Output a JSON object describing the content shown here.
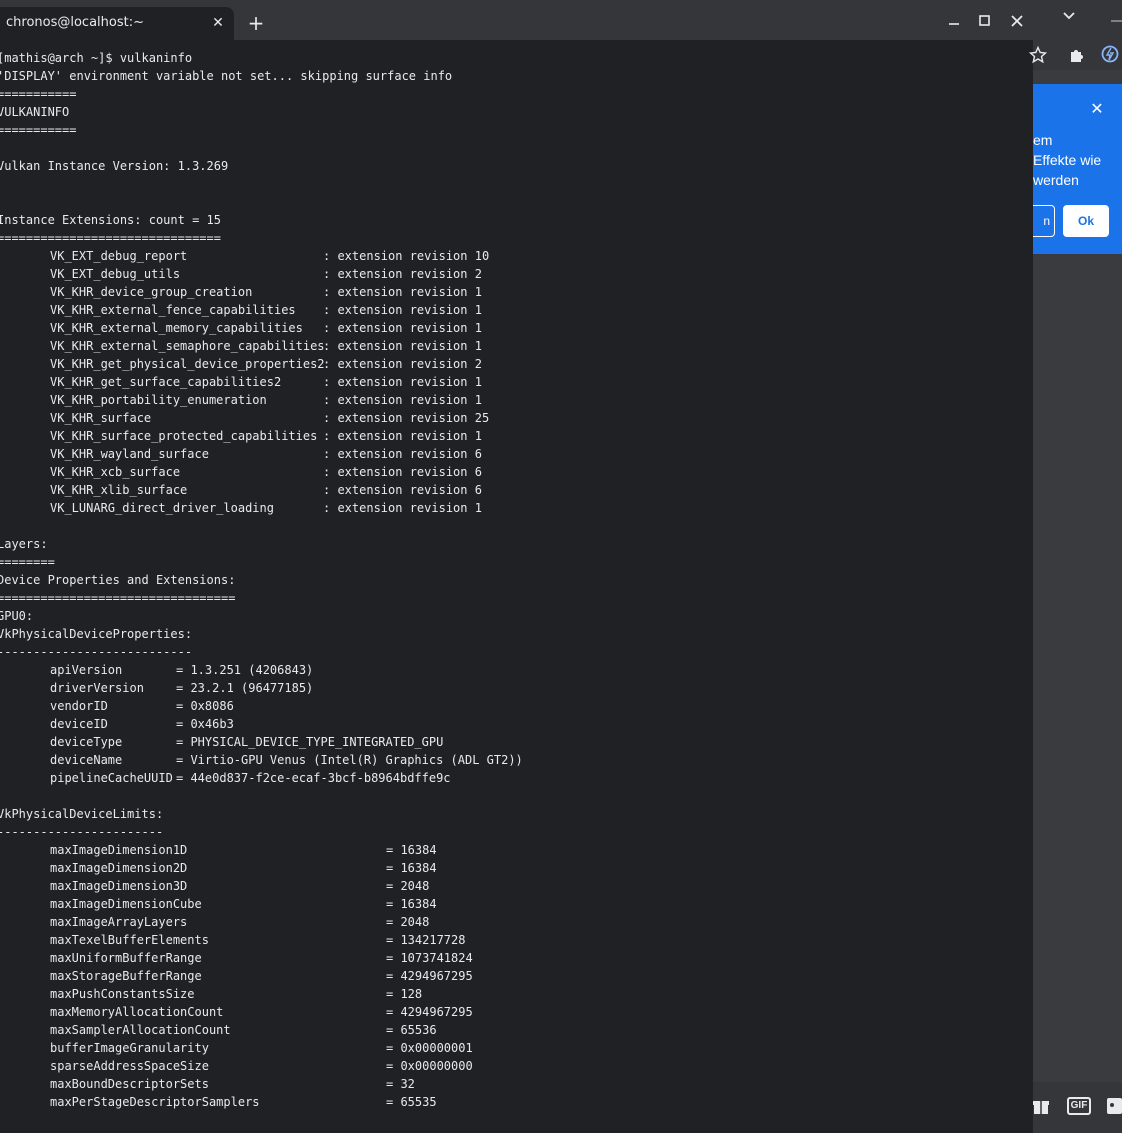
{
  "terminal": {
    "tab_title": "chronos@localhost:~",
    "tab_close_glyph": "✕",
    "new_tab_glyph": "+",
    "lines": [
      {
        "type": "single",
        "text": "[mathis@arch ~]$ vulkaninfo"
      },
      {
        "type": "single",
        "text": "'DISPLAY' environment variable not set... skipping surface info"
      },
      {
        "type": "single",
        "text": "==========="
      },
      {
        "type": "single",
        "text": "VULKANINFO"
      },
      {
        "type": "single",
        "text": "==========="
      },
      {
        "type": "single",
        "text": ""
      },
      {
        "type": "single",
        "text": "Vulkan Instance Version: 1.3.269"
      },
      {
        "type": "single",
        "text": ""
      },
      {
        "type": "single",
        "text": ""
      },
      {
        "type": "single",
        "text": "Instance Extensions: count = 15"
      },
      {
        "type": "single",
        "text": "==============================="
      },
      {
        "type": "ext",
        "name": "VK_EXT_debug_report",
        "value": ": extension revision 10"
      },
      {
        "type": "ext",
        "name": "VK_EXT_debug_utils",
        "value": ": extension revision 2"
      },
      {
        "type": "ext",
        "name": "VK_KHR_device_group_creation",
        "value": ": extension revision 1"
      },
      {
        "type": "ext",
        "name": "VK_KHR_external_fence_capabilities",
        "value": ": extension revision 1"
      },
      {
        "type": "ext",
        "name": "VK_KHR_external_memory_capabilities",
        "value": ": extension revision 1"
      },
      {
        "type": "ext",
        "name": "VK_KHR_external_semaphore_capabilities",
        "value": ": extension revision 1"
      },
      {
        "type": "ext",
        "name": "VK_KHR_get_physical_device_properties2",
        "value": ": extension revision 2"
      },
      {
        "type": "ext",
        "name": "VK_KHR_get_surface_capabilities2",
        "value": ": extension revision 1"
      },
      {
        "type": "ext",
        "name": "VK_KHR_portability_enumeration",
        "value": ": extension revision 1"
      },
      {
        "type": "ext",
        "name": "VK_KHR_surface",
        "value": ": extension revision 25"
      },
      {
        "type": "ext",
        "name": "VK_KHR_surface_protected_capabilities",
        "value": ": extension revision 1"
      },
      {
        "type": "ext",
        "name": "VK_KHR_wayland_surface",
        "value": ": extension revision 6"
      },
      {
        "type": "ext",
        "name": "VK_KHR_xcb_surface",
        "value": ": extension revision 6"
      },
      {
        "type": "ext",
        "name": "VK_KHR_xlib_surface",
        "value": ": extension revision 6"
      },
      {
        "type": "ext",
        "name": "VK_LUNARG_direct_driver_loading",
        "value": ": extension revision 1"
      },
      {
        "type": "single",
        "text": ""
      },
      {
        "type": "single",
        "text": "Layers:"
      },
      {
        "type": "single",
        "text": "========"
      },
      {
        "type": "single",
        "text": "Device Properties and Extensions:"
      },
      {
        "type": "single",
        "text": "================================="
      },
      {
        "type": "single",
        "text": "GPU0:"
      },
      {
        "type": "single",
        "text": "VkPhysicalDeviceProperties:"
      },
      {
        "type": "single",
        "text": "---------------------------"
      },
      {
        "type": "prop",
        "name": "apiVersion",
        "value": "= 1.3.251 (4206843)"
      },
      {
        "type": "prop",
        "name": "driverVersion",
        "value": "= 23.2.1 (96477185)"
      },
      {
        "type": "prop",
        "name": "vendorID",
        "value": "= 0x8086"
      },
      {
        "type": "prop",
        "name": "deviceID",
        "value": "= 0x46b3"
      },
      {
        "type": "prop",
        "name": "deviceType",
        "value": "= PHYSICAL_DEVICE_TYPE_INTEGRATED_GPU"
      },
      {
        "type": "prop",
        "name": "deviceName",
        "value": "= Virtio-GPU Venus (Intel(R) Graphics (ADL GT2))"
      },
      {
        "type": "prop",
        "name": "pipelineCacheUUID",
        "value": "= 44e0d837-f2ce-ecaf-3bcf-b8964bdffe9c"
      },
      {
        "type": "single",
        "text": ""
      },
      {
        "type": "single",
        "text": "VkPhysicalDeviceLimits:"
      },
      {
        "type": "single",
        "text": "-----------------------"
      },
      {
        "type": "lim",
        "name": "maxImageDimension1D",
        "value": "= 16384"
      },
      {
        "type": "lim",
        "name": "maxImageDimension2D",
        "value": "= 16384"
      },
      {
        "type": "lim",
        "name": "maxImageDimension3D",
        "value": "= 2048"
      },
      {
        "type": "lim",
        "name": "maxImageDimensionCube",
        "value": "= 16384"
      },
      {
        "type": "lim",
        "name": "maxImageArrayLayers",
        "value": "= 2048"
      },
      {
        "type": "lim",
        "name": "maxTexelBufferElements",
        "value": "= 134217728"
      },
      {
        "type": "lim",
        "name": "maxUniformBufferRange",
        "value": "= 1073741824"
      },
      {
        "type": "lim",
        "name": "maxStorageBufferRange",
        "value": "= 4294967295"
      },
      {
        "type": "lim",
        "name": "maxPushConstantsSize",
        "value": "= 128"
      },
      {
        "type": "lim",
        "name": "maxMemoryAllocationCount",
        "value": "= 4294967295"
      },
      {
        "type": "lim",
        "name": "maxSamplerAllocationCount",
        "value": "= 65536"
      },
      {
        "type": "lim",
        "name": "bufferImageGranularity",
        "value": "= 0x00000001"
      },
      {
        "type": "lim",
        "name": "sparseAddressSpaceSize",
        "value": "= 0x00000000"
      },
      {
        "type": "lim",
        "name": "maxBoundDescriptorSets",
        "value": "= 32"
      },
      {
        "type": "lim",
        "name": "maxPerStageDescriptorSamplers",
        "value": "= 65535"
      }
    ]
  },
  "popup": {
    "lines": [
      "em",
      "Effekte wie",
      "werden"
    ],
    "close_glyph": "✕",
    "left_button_label": "n",
    "ok_label": "Ok"
  },
  "bottom_bar": {
    "gif_label": "GIF"
  },
  "colors": {
    "terminal_bg": "#202124",
    "terminal_text": "#e8eaed",
    "titlebar": "#35363a",
    "popup_blue": "#1a73e8"
  }
}
